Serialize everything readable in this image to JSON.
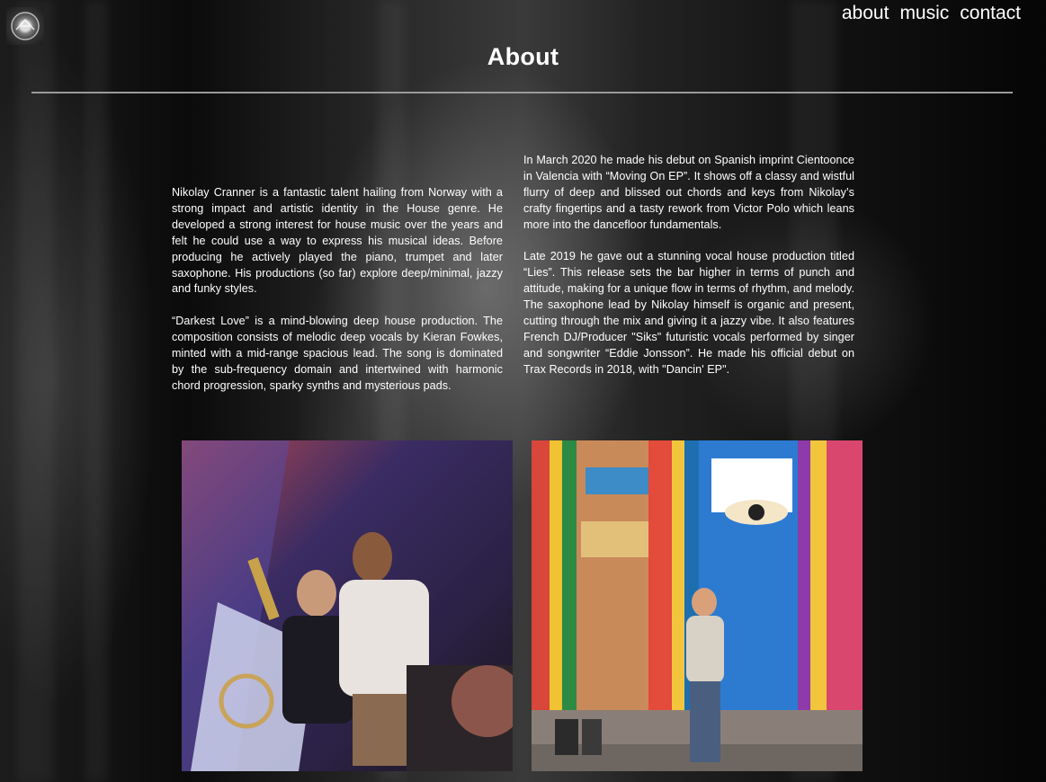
{
  "nav": {
    "items": [
      {
        "label": "about"
      },
      {
        "label": "music"
      },
      {
        "label": "contact"
      }
    ]
  },
  "page": {
    "title": "About"
  },
  "content": {
    "left": [
      "Nikolay Cranner is a fantastic talent hailing from Norway with a strong impact and artistic identity in the House genre. He developed a strong interest for house music over the years and felt he could use a way to express his musical ideas. Before producing he actively played the piano, trumpet and later saxophone. His productions (so far) explore deep/minimal, jazzy and funky styles.",
      "“Darkest Love” is a mind-blowing deep house production. The composition consists of melodic deep vocals by Kieran Fowkes, minted with a mid-range spacious lead. The song is dominated by the sub-frequency domain and intertwined with harmonic chord progression, sparky synths and mysterious pads."
    ],
    "right": [
      "In March 2020 he made his debut on Spanish imprint Cientoonce in Valencia with “Moving On EP”. It shows off a classy and wistful flurry of deep and blissed out chords and keys from Nikolay’s crafty fingertips and a tasty rework from Victor Polo which leans more into the dancefloor fundamentals.",
      "Late 2019 he gave out a stunning vocal house production titled “Lies”. This release sets the bar higher in terms of punch and attitude, making for a unique flow in terms of rhythm, and melody. The saxophone lead by Nikolay himself is organic and present, cutting through the mix and giving it a jazzy vibe. It also features French DJ/Producer \"Siks\" futuristic vocals performed by singer and songwriter “Eddie Jonsson”. He made his official debut on Trax Records in 2018, with \"Dancin' EP\"."
    ]
  },
  "icons": {
    "logo": "logo-icon"
  },
  "colors": {
    "text": "#ffffff",
    "rule": "#9a9a9a",
    "background": "#0a0a0a"
  }
}
